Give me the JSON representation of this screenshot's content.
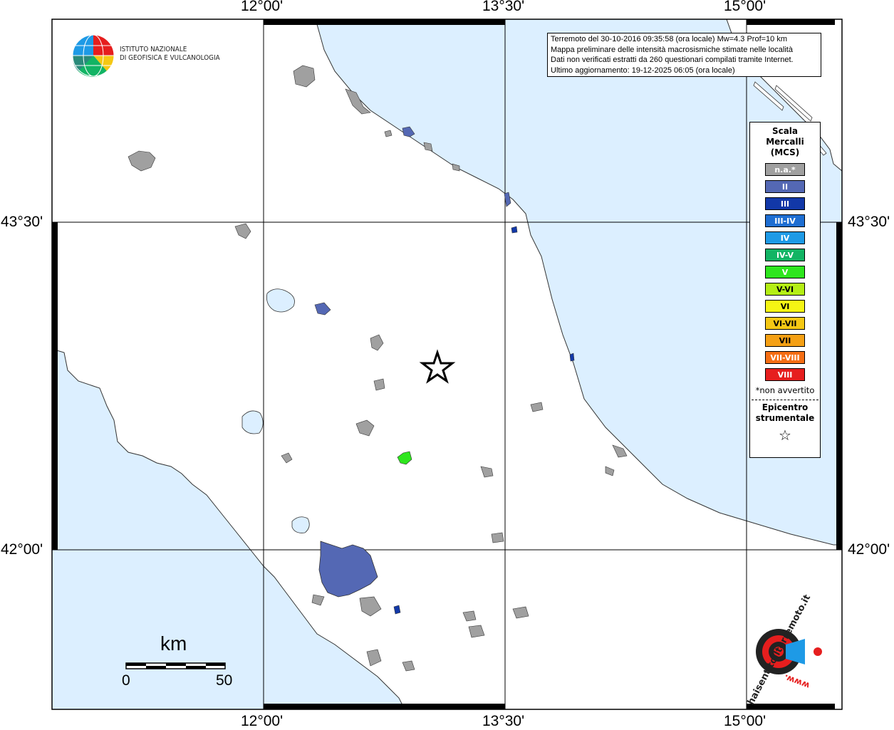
{
  "map": {
    "lon_labels": [
      "12°00'",
      "13°30'",
      "15°00'"
    ],
    "lat_labels": [
      "43°30'",
      "42°00'"
    ]
  },
  "logo": {
    "ingv_line1": "ISTITUTO NAZIONALE",
    "ingv_line2": "DI GEOFISICA E VULCANOLOGIA",
    "hsit_text": "haisentitoilterremoto.it",
    "hsit_www": "www."
  },
  "info": {
    "line1": "Terremoto del 30-10-2016 09:35:58 (ora locale) Mw=4.3 Prof=10 km",
    "line2": "Mappa preliminare delle intensità macrosismiche stimate nelle località",
    "line3": "Dati non verificati estratti da 260 questionari compilati tramite Internet.",
    "line4": "Ultimo aggiornamento: 19-12-2025 06:05 (ora locale)"
  },
  "legend": {
    "title1": "Scala",
    "title2": "Mercalli",
    "title3": "(MCS)",
    "items": [
      {
        "label": "n.a.*",
        "color": "#a0a0a0"
      },
      {
        "label": "II",
        "color": "#5468b4"
      },
      {
        "label": "III",
        "color": "#1238a8"
      },
      {
        "label": "III-IV",
        "color": "#1e6ed2"
      },
      {
        "label": "IV",
        "color": "#1e9ae6"
      },
      {
        "label": "IV-V",
        "color": "#12b464"
      },
      {
        "label": "V",
        "color": "#2ee61e"
      },
      {
        "label": "V-VI",
        "color": "#b4ee14"
      },
      {
        "label": "VI",
        "color": "#f5f514"
      },
      {
        "label": "VI-VII",
        "color": "#f5c814"
      },
      {
        "label": "VII",
        "color": "#f5a014"
      },
      {
        "label": "VII-VIII",
        "color": "#f56e14"
      },
      {
        "label": "VIII",
        "color": "#e61e1e"
      }
    ],
    "note": "*non avvertito",
    "epi1": "Epicentro",
    "epi2": "strumentale",
    "epi_symbol": "☆"
  },
  "scale_bar": {
    "unit": "km",
    "start": "0",
    "end": "50"
  },
  "colors": {
    "sea": "#dcefff",
    "land": "#ffffff",
    "na": "#a0a0a0",
    "II": "#5468b4",
    "III": "#1238a8",
    "V": "#2ee61e"
  }
}
